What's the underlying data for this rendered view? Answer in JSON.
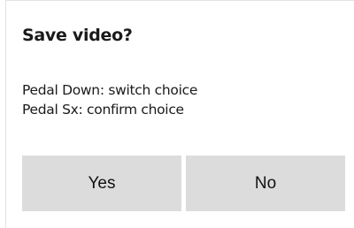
{
  "dialog": {
    "title": "Save video?",
    "lines": [
      "Pedal Down: switch choice",
      "Pedal Sx: confirm choice"
    ],
    "buttons": {
      "yes_label": "Yes",
      "no_label": "No"
    }
  },
  "colors": {
    "background": "#ffffff",
    "button_fill": "#dcdcdc",
    "text": "#1a1a1a",
    "border": "#e2e2e2"
  }
}
